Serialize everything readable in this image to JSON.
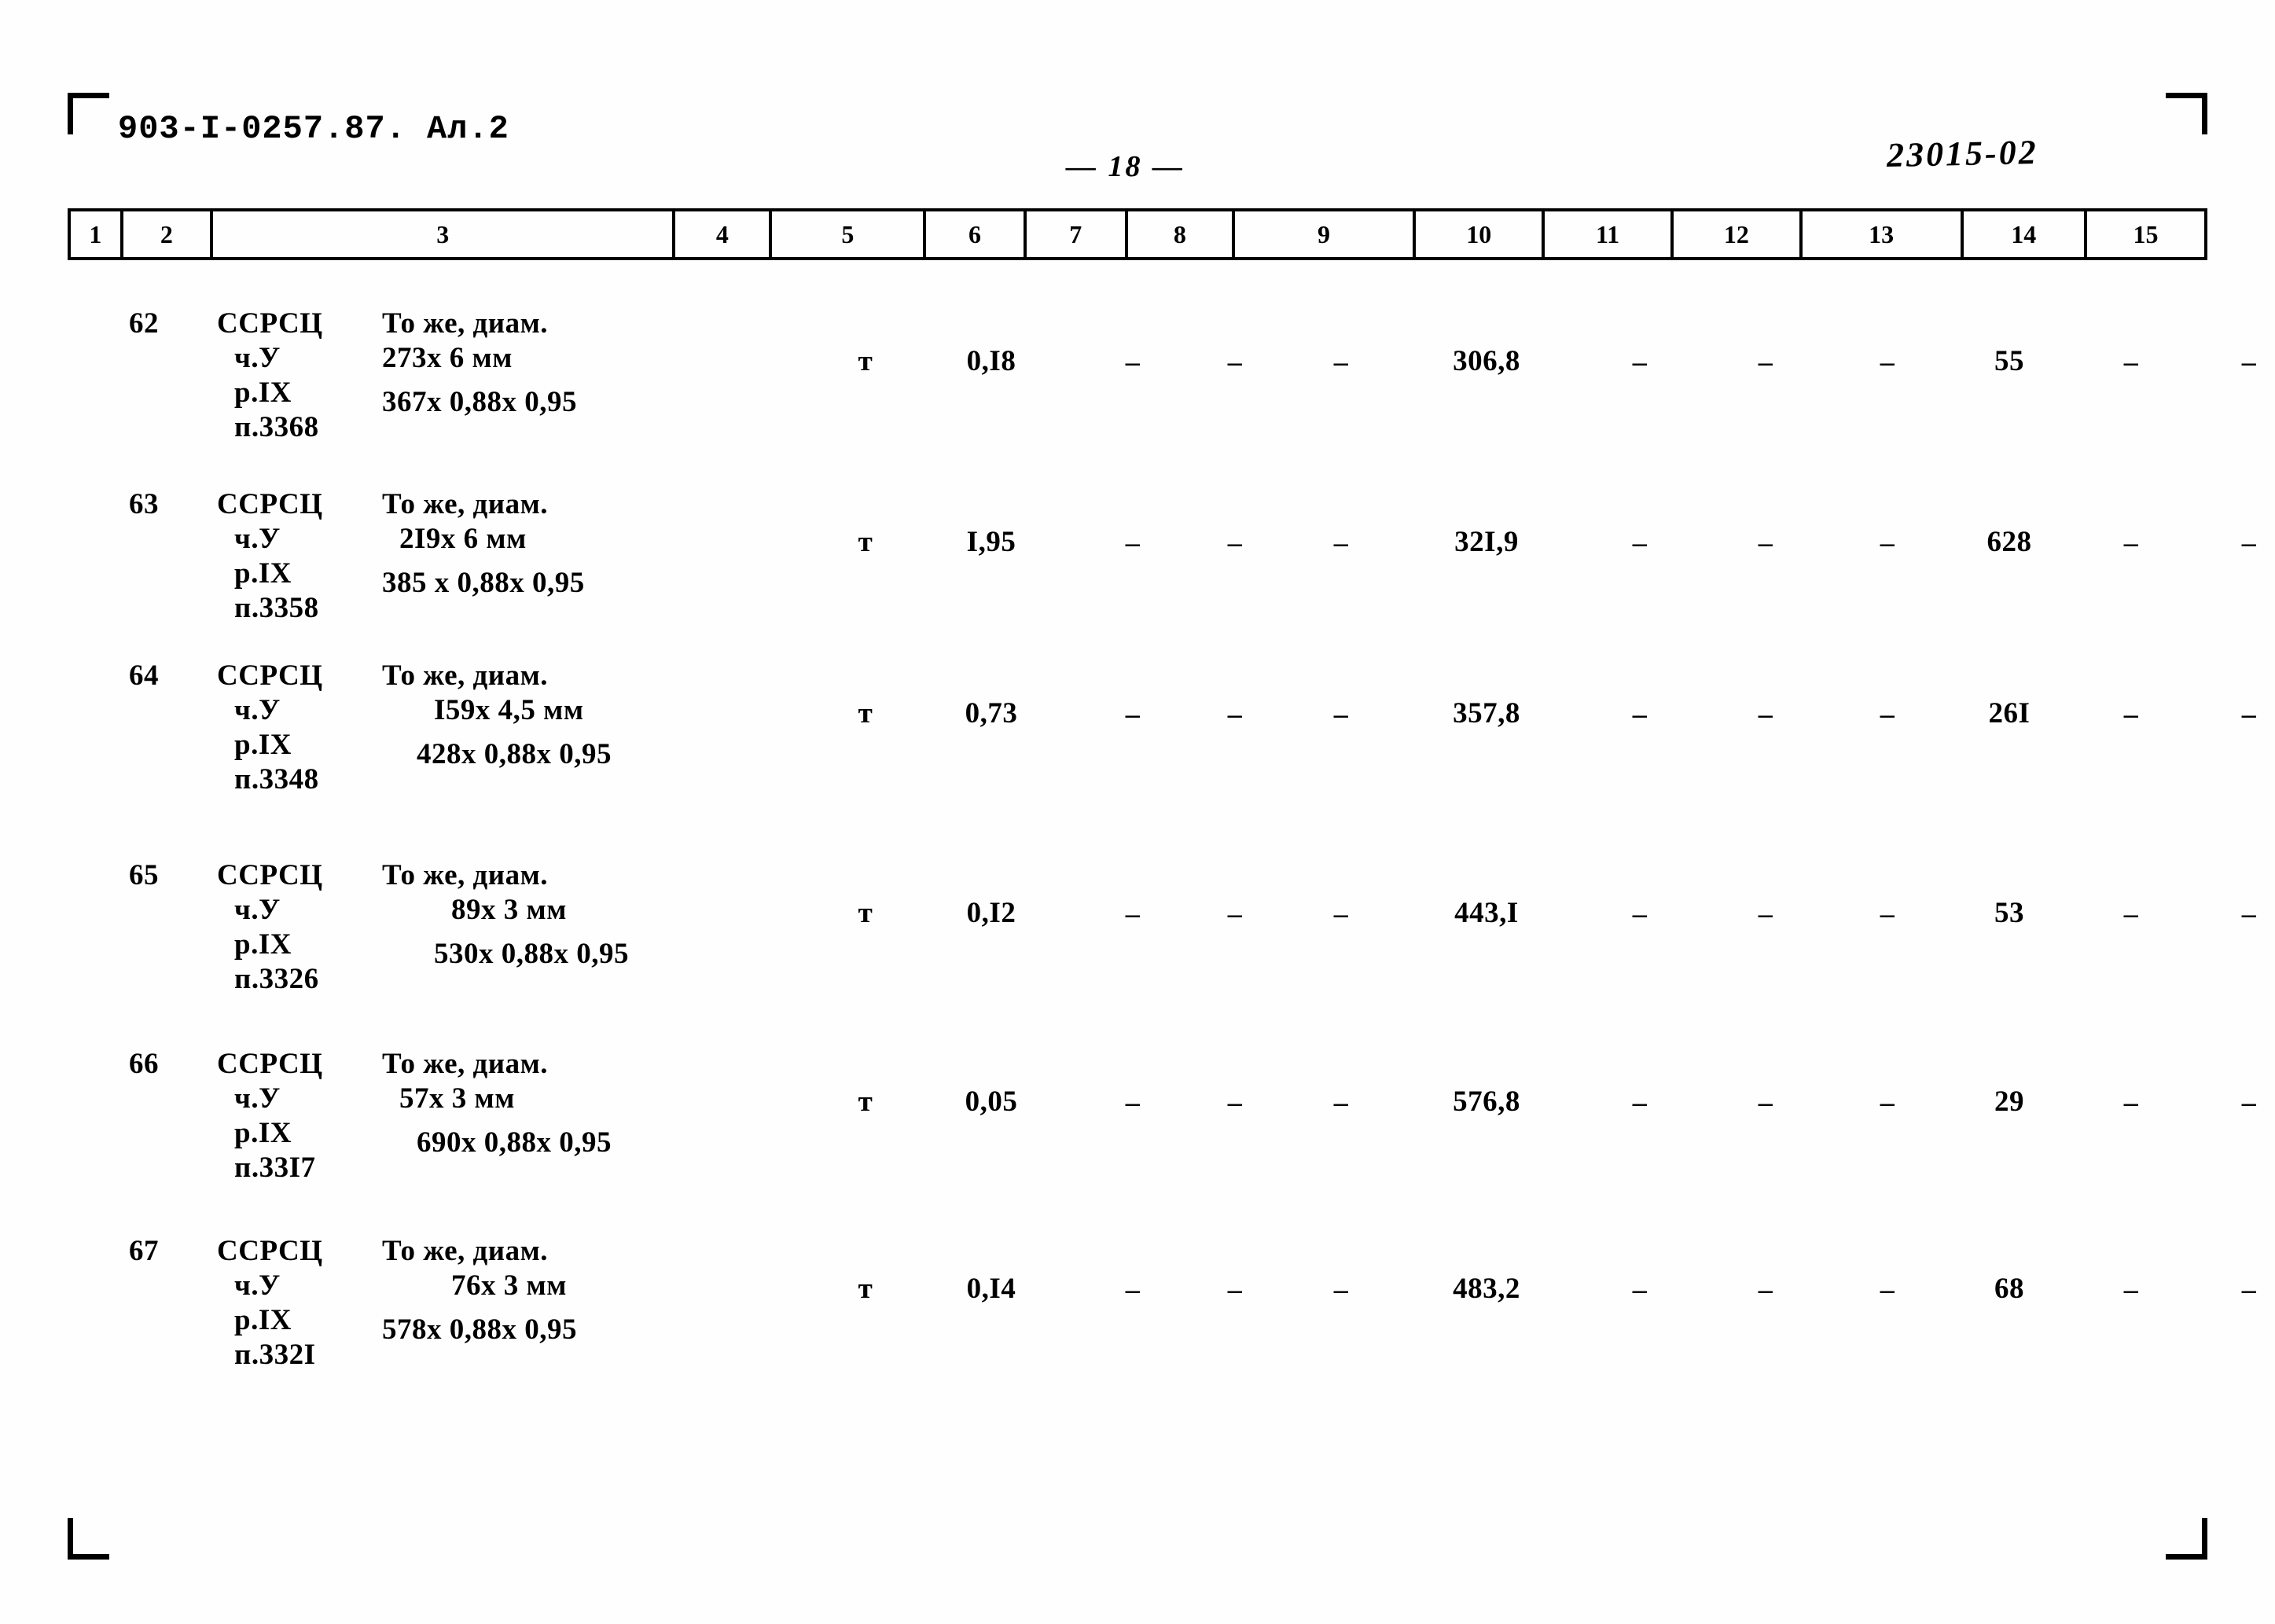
{
  "document": {
    "code": "903-I-0257.87. Ал.2",
    "page_marker": "— 18 —",
    "archive_stamp": "23015-02"
  },
  "table": {
    "column_headers": [
      "1",
      "2",
      "3",
      "4",
      "5",
      "6",
      "7",
      "8",
      "9",
      "10",
      "11",
      "12",
      "13",
      "14",
      "15"
    ],
    "rows": [
      {
        "c1": "62",
        "c2_lines": [
          "ССРСЦ",
          "ч.У",
          "р.IX",
          "п.3368"
        ],
        "c3_lines": [
          "То же, диам.",
          "273х 6 мм",
          "367х 0,88х 0,95"
        ],
        "c4": "т",
        "c5": "0,I8",
        "c6": "–",
        "c7": "–",
        "c8": "–",
        "c9": "306,8",
        "c10": "–",
        "c11": "–",
        "c12": "–",
        "c13": "55",
        "c14": "–",
        "c15": "–"
      },
      {
        "c1": "63",
        "c2_lines": [
          "ССРСЦ",
          "ч.У",
          "р.IX",
          "п.3358"
        ],
        "c3_lines": [
          "То же, диам.",
          "2I9х 6 мм",
          "385 х 0,88х 0,95"
        ],
        "c4": "т",
        "c5": "I,95",
        "c6": "–",
        "c7": "–",
        "c8": "–",
        "c9": "32I,9",
        "c10": "–",
        "c11": "–",
        "c12": "–",
        "c13": "628",
        "c14": "–",
        "c15": "–"
      },
      {
        "c1": "64",
        "c2_lines": [
          "ССРСЦ",
          "ч.У",
          "р.IX",
          "п.3348"
        ],
        "c3_lines": [
          "То же, диам.",
          "I59х 4,5 мм",
          "428х 0,88х 0,95"
        ],
        "c4": "т",
        "c5": "0,73",
        "c6": "–",
        "c7": "–",
        "c8": "–",
        "c9": "357,8",
        "c10": "–",
        "c11": "–",
        "c12": "–",
        "c13": "26I",
        "c14": "–",
        "c15": "–"
      },
      {
        "c1": "65",
        "c2_lines": [
          "ССРСЦ",
          "ч.У",
          "р.IX",
          "п.3326"
        ],
        "c3_lines": [
          "То же, диам.",
          "89х 3 мм",
          "530х 0,88х 0,95"
        ],
        "c4": "т",
        "c5": "0,I2",
        "c6": "–",
        "c7": "–",
        "c8": "–",
        "c9": "443,I",
        "c10": "–",
        "c11": "–",
        "c12": "–",
        "c13": "53",
        "c14": "–",
        "c15": "–"
      },
      {
        "c1": "66",
        "c2_lines": [
          "ССРСЦ",
          "ч.У",
          "р.IX",
          "п.33I7"
        ],
        "c3_lines": [
          "То же, диам.",
          "57х 3 мм",
          "690х 0,88х 0,95"
        ],
        "c4": "т",
        "c5": "0,05",
        "c6": "–",
        "c7": "–",
        "c8": "–",
        "c9": "576,8",
        "c10": "–",
        "c11": "–",
        "c12": "–",
        "c13": "29",
        "c14": "–",
        "c15": "–"
      },
      {
        "c1": "67",
        "c2_lines": [
          "ССРСЦ",
          "ч.У",
          "р.IX",
          "п.332I"
        ],
        "c3_lines": [
          "То же, диам.",
          "76х 3 мм",
          "578х 0,88х 0,95"
        ],
        "c4": "т",
        "c5": "0,I4",
        "c6": "–",
        "c7": "–",
        "c8": "–",
        "c9": "483,2",
        "c10": "–",
        "c11": "–",
        "c12": "–",
        "c13": "68",
        "c14": "–",
        "c15": "–"
      }
    ]
  }
}
